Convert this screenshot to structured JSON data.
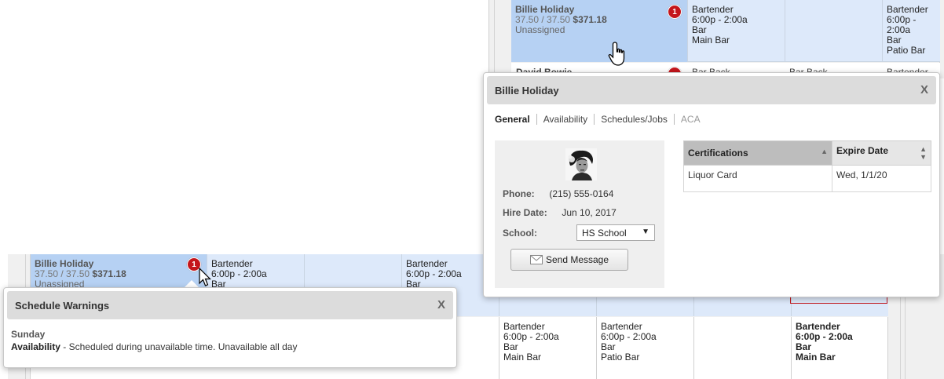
{
  "top_row": {
    "employee": {
      "name": "Billie Holiday",
      "hours": "37.50 / 37.50",
      "pay": "$371.18",
      "status": "Unassigned",
      "warning_count": "1"
    },
    "cells": [
      {
        "role": "Bartender",
        "time": "6:00p - 2:00a",
        "location": "Bar",
        "area": "Main Bar"
      },
      {
        "role": "",
        "time": "",
        "location": "",
        "area": ""
      },
      {
        "role": "Bartender",
        "time": "6:00p - 2:00a",
        "location": "Bar",
        "area": "Patio Bar"
      }
    ]
  },
  "peek_row": {
    "name": "David Bowie",
    "cell1": "Bar Back",
    "cell2": "Bar Back",
    "cell3": "Bartender"
  },
  "bottom_row1": {
    "employee": {
      "name": "Billie Holiday",
      "hours": "37.50 / 37.50",
      "pay": "$371.18",
      "status": "Unassigned",
      "warning_count": "1"
    },
    "cells": [
      {
        "role": "Bartender",
        "time": "6:00p - 2:00a",
        "location": "Bar"
      },
      {
        "role": "Bartender",
        "time": "6:00p - 2:00a",
        "location": "Bar"
      }
    ]
  },
  "bottom_row2": {
    "partial_time": "0a",
    "cells": [
      {
        "role": "Bartender",
        "time": "6:00p - 2:00a",
        "location": "Bar",
        "area": "Main Bar"
      },
      {
        "role": "Bartender",
        "time": "6:00p - 2:00a",
        "location": "Bar",
        "area": "Patio Bar"
      },
      {
        "role": "Bartender",
        "time": "6:00p - 2:00a",
        "location": "Bar",
        "area": "Main Bar"
      }
    ]
  },
  "warnings_popup": {
    "title": "Schedule Warnings",
    "close": "X",
    "day": "Sunday",
    "type": "Availability",
    "message": " - Scheduled during unavailable time. Unavailable all day"
  },
  "employee_popup": {
    "title": "Billie Holiday",
    "close": "X",
    "tabs": [
      "General",
      "Availability",
      "Schedules/Jobs",
      "ACA"
    ],
    "phone_label": "Phone:",
    "phone": "(215) 555-0164",
    "hire_label": "Hire Date:",
    "hire_date": "Jun 10, 2017",
    "school_label": "School:",
    "school": "HS School",
    "send_button": "Send Message",
    "cert_headers": [
      "Certifications",
      "Expire Date"
    ],
    "certs": [
      {
        "name": "Liquor Card",
        "expires": "Wed, 1/1/20"
      }
    ]
  },
  "colors": {
    "accent_blue": "#b6d1f3",
    "row_blue": "#dde9fa",
    "warning_red": "#c4161c"
  }
}
